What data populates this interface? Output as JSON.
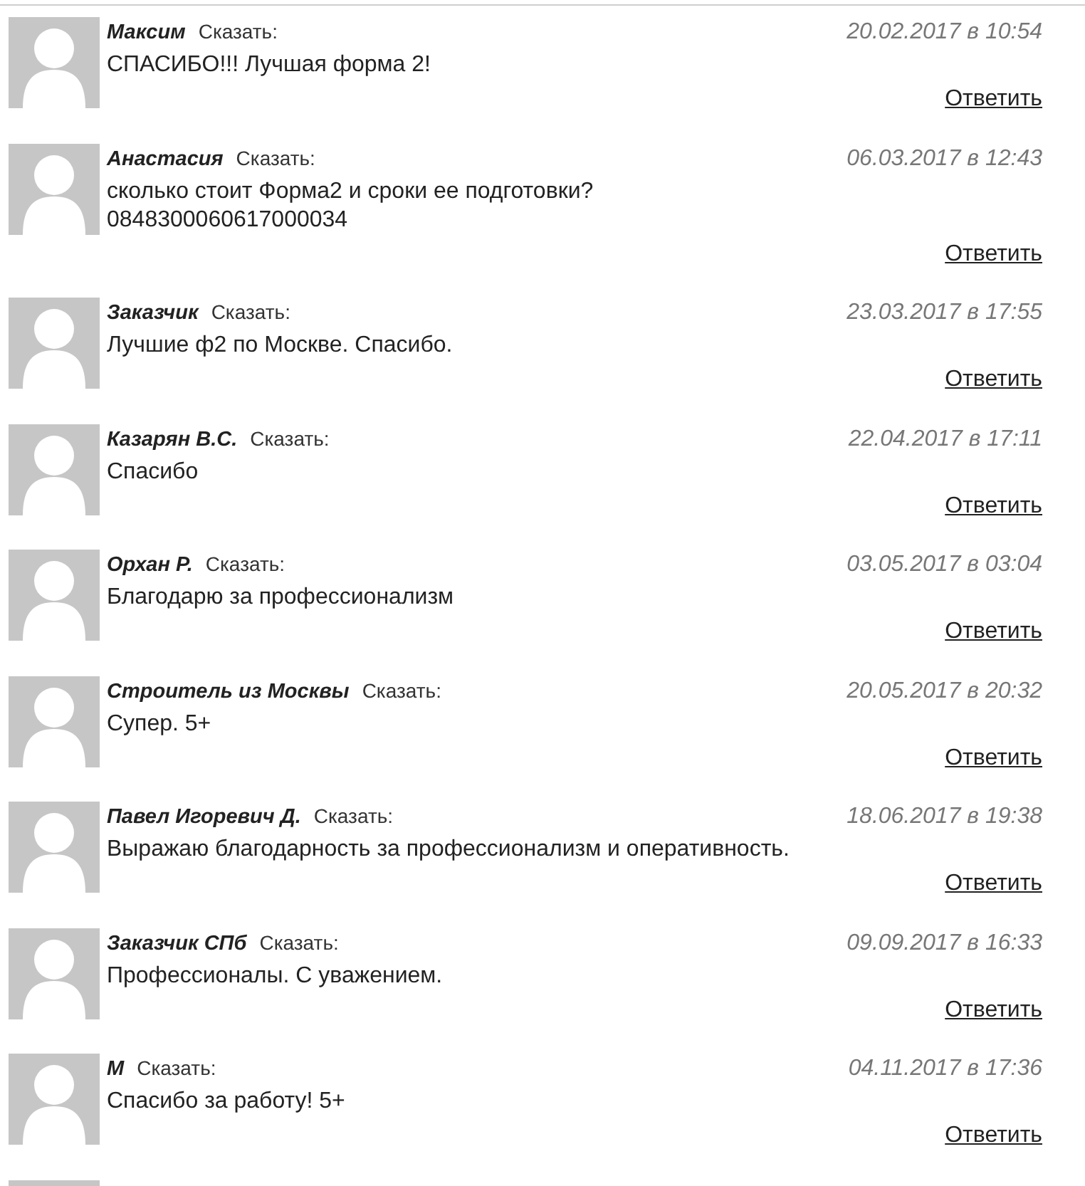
{
  "comments": [
    {
      "author": "Максим",
      "say": "Сказать:",
      "date": "20.02.2017 в 10:54",
      "lines": [
        "СПАСИБО!!! Лучшая форма 2!"
      ],
      "reply": "Ответить"
    },
    {
      "author": "Анастасия",
      "say": "Сказать:",
      "date": "06.03.2017 в 12:43",
      "lines": [
        "сколько стоит Форма2 и сроки ее подготовки?",
        "0848300060617000034"
      ],
      "reply": "Ответить"
    },
    {
      "author": "Заказчик",
      "say": "Сказать:",
      "date": "23.03.2017 в 17:55",
      "lines": [
        "Лучшие ф2 по Москве. Спасибо."
      ],
      "reply": "Ответить"
    },
    {
      "author": "Казарян В.С.",
      "say": "Сказать:",
      "date": "22.04.2017 в 17:11",
      "lines": [
        "Спасибо"
      ],
      "reply": "Ответить"
    },
    {
      "author": "Орхан Р.",
      "say": "Сказать:",
      "date": "03.05.2017 в 03:04",
      "lines": [
        "Благодарю за профессионализм"
      ],
      "reply": "Ответить"
    },
    {
      "author": "Строитель из Москвы",
      "say": "Сказать:",
      "date": "20.05.2017 в 20:32",
      "lines": [
        "Супер. 5+"
      ],
      "reply": "Ответить"
    },
    {
      "author": "Павел Игоревич Д.",
      "say": "Сказать:",
      "date": "18.06.2017 в 19:38",
      "lines": [
        "Выражаю благодарность за профессионализм и оперативность."
      ],
      "reply": "Ответить"
    },
    {
      "author": "Заказчик СПб",
      "say": "Сказать:",
      "date": "09.09.2017 в 16:33",
      "lines": [
        "Профессионалы. С уважением."
      ],
      "reply": "Ответить"
    },
    {
      "author": "М",
      "say": "Сказать:",
      "date": "04.11.2017 в 17:36",
      "lines": [
        "Спасибо за работу! 5+"
      ],
      "reply": "Ответить"
    }
  ],
  "next_comment_cut_off": true
}
